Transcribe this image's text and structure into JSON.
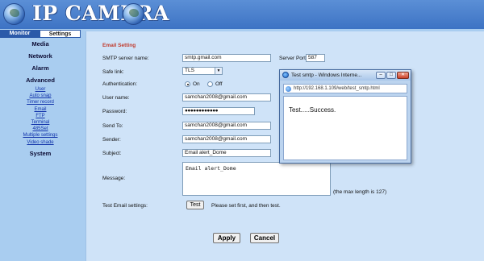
{
  "header": {
    "brand": "IP CAMERA"
  },
  "tabs": [
    {
      "label": "Monitor",
      "active": false
    },
    {
      "label": "Settings",
      "active": true
    }
  ],
  "sidebar": {
    "media": "Media",
    "network": "Network",
    "alarm": "Alarm",
    "advanced": "Advanced",
    "advanced_items": [
      "User",
      "Auto snap",
      "Timer record",
      "Email",
      "FTP",
      "Terminal",
      "485Set",
      "Multiple settings",
      "Video shade"
    ],
    "system": "System"
  },
  "form": {
    "section_title": "Email Setting",
    "smtp_label": "SMTP server name:",
    "smtp_value": "smtp.gmail.com",
    "port_label": "Server Port",
    "port_value": "587",
    "safe_link_label": "Safe link:",
    "safe_link_value": "TLS",
    "auth_label": "Authentication:",
    "auth_on": "On",
    "auth_off": "Off",
    "auth_selected": "On",
    "username_label": "User name:",
    "username_value": "samchan2008@gmail.com",
    "password_label": "Password:",
    "password_value": "●●●●●●●●●●●●",
    "send_to_label": "Send To:",
    "send_to_value": "samchan2008@gmail.com",
    "sender_label": "Sender:",
    "sender_value": "samchan2008@gmail.com",
    "subject_label": "Subject:",
    "subject_value": "Email alert_Dome",
    "message_label": "Message:",
    "message_value": "Email alert_Dome",
    "max_length_note": "(the max length is 127)",
    "test_label": "Test Email settings:",
    "test_button": "Test",
    "test_hint": "Please set first, and then test.",
    "apply_button": "Apply",
    "cancel_button": "Cancel"
  },
  "popup": {
    "title": "Test smtp - Windows Interne...",
    "url": "http://192.168.1.109/web/test_smtp.html",
    "message": "Test.....Success."
  }
}
